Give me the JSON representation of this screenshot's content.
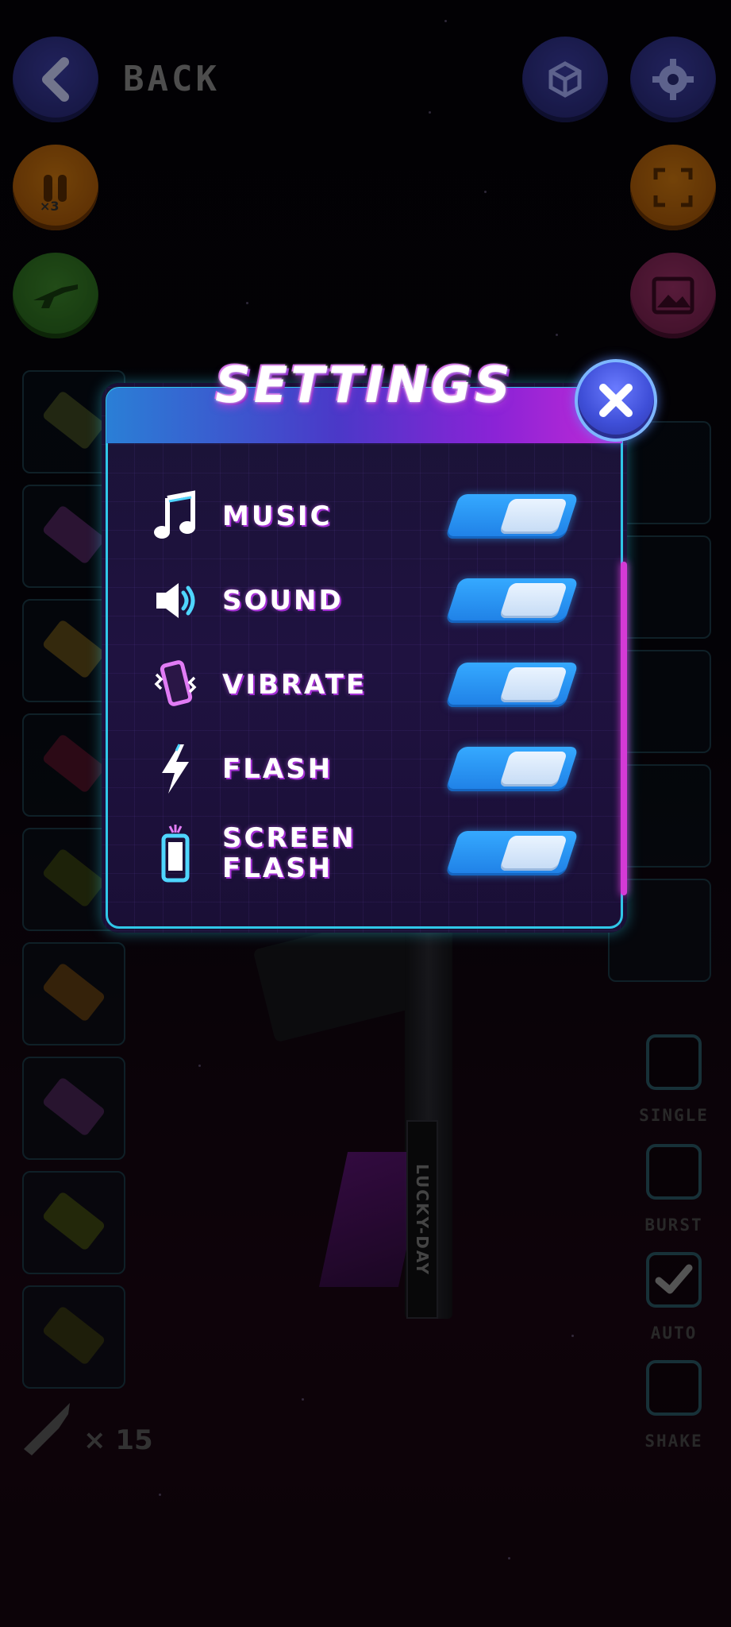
{
  "top_bar": {
    "back_label": "BACK",
    "x3_label": "×3"
  },
  "settings": {
    "title": "SETTINGS",
    "close_icon": "close-x-icon",
    "rows": [
      {
        "icon": "music-note-icon",
        "label": "MUSIC",
        "enabled": true
      },
      {
        "icon": "speaker-icon",
        "label": "SOUND",
        "enabled": true
      },
      {
        "icon": "vibrate-phone-icon",
        "label": "VIBRATE",
        "enabled": true
      },
      {
        "icon": "lightning-icon",
        "label": "FLASH",
        "enabled": true
      },
      {
        "icon": "screen-flash-phone-icon",
        "label": "SCREEN FLASH",
        "enabled": true
      }
    ]
  },
  "fire_modes": [
    {
      "label": "SINGLE",
      "checked": false
    },
    {
      "label": "BURST",
      "checked": false
    },
    {
      "label": "AUTO",
      "checked": true
    },
    {
      "label": "SHAKE",
      "checked": false
    }
  ],
  "ammo": {
    "count_label": "× 15"
  },
  "weapon": {
    "tag": "LUCKY-DAY"
  },
  "colors": {
    "panel_border_cyan": "#2fc7e8",
    "panel_accent_magenta": "#d43ad6",
    "toggle_on": "#2f9cf6",
    "title_glow": "#8a26c8"
  }
}
